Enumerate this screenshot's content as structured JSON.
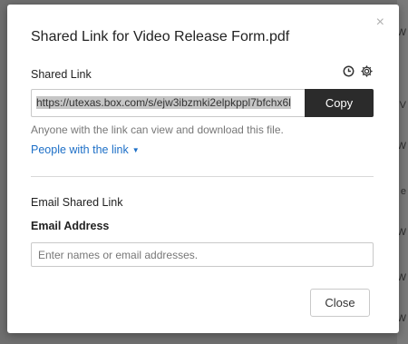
{
  "dialog": {
    "title": "Shared Link for Video Release Form.pdf",
    "close_symbol": "×"
  },
  "shared_link": {
    "section_label": "Shared Link",
    "url": "https://utexas.box.com/s/ejw3ibzmki2elpkppl7bfchx6l",
    "copy_label": "Copy",
    "help_text": "Anyone with the link can view and download this file.",
    "access_level": "People with the link",
    "icons": [
      "clock-icon",
      "gear-icon"
    ]
  },
  "email": {
    "section_title": "Email Shared Link",
    "field_label": "Email Address",
    "placeholder": "Enter names or email addresses."
  },
  "footer": {
    "close_label": "Close"
  },
  "colors": {
    "accent_link": "#1d6fc7",
    "copy_button": "#2b2b2b",
    "backdrop": "#6f6f6f"
  }
}
